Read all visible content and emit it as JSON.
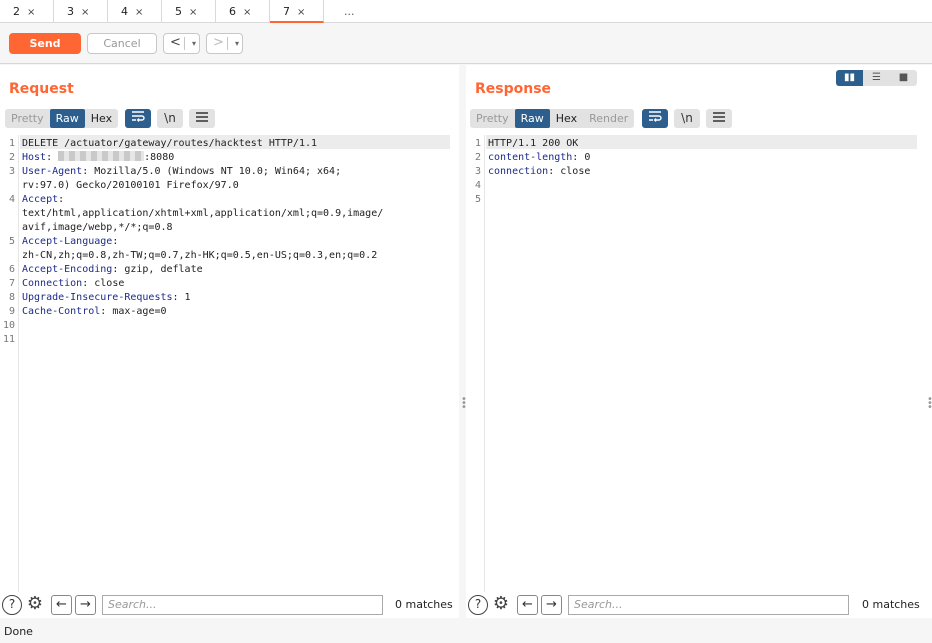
{
  "tabs": [
    {
      "label": "2",
      "close": "×"
    },
    {
      "label": "3",
      "close": "×"
    },
    {
      "label": "4",
      "close": "×"
    },
    {
      "label": "5",
      "close": "×"
    },
    {
      "label": "6",
      "close": "×"
    },
    {
      "label": "7",
      "close": "×"
    }
  ],
  "tabs_more": "...",
  "active_tab": "7",
  "toolbar": {
    "send_label": "Send",
    "cancel_label": "Cancel",
    "back_glyph": "<",
    "forward_glyph": ">",
    "dropdown_glyph": "▾"
  },
  "colors": {
    "accent": "#ff6633",
    "selected": "#2c5f8e"
  },
  "request": {
    "title": "Request",
    "view_modes": [
      "Pretty",
      "Raw",
      "Hex"
    ],
    "active_mode": "Raw",
    "tools": [
      "wrap-icon",
      "\\n",
      "menu-icon"
    ],
    "newline_label": "\\n",
    "lines": [
      {
        "n": "1",
        "key": "",
        "text": "DELETE /actuator/gateway/routes/hacktest HTTP/1.1"
      },
      {
        "n": "2",
        "key": "Host",
        "text": ":8080",
        "redacted": true
      },
      {
        "n": "3",
        "key": "User-Agent",
        "text": ": Mozilla/5.0 (Windows NT 10.0; Win64; x64;"
      },
      {
        "n": "",
        "key": "",
        "text": "rv:97.0) Gecko/20100101 Firefox/97.0"
      },
      {
        "n": "4",
        "key": "Accept",
        "text": ":"
      },
      {
        "n": "",
        "key": "",
        "text": "text/html,application/xhtml+xml,application/xml;q=0.9,image/"
      },
      {
        "n": "",
        "key": "",
        "text": "avif,image/webp,*/*;q=0.8"
      },
      {
        "n": "5",
        "key": "Accept-Language",
        "text": ":"
      },
      {
        "n": "",
        "key": "",
        "text": "zh-CN,zh;q=0.8,zh-TW;q=0.7,zh-HK;q=0.5,en-US;q=0.3,en;q=0.2"
      },
      {
        "n": "6",
        "key": "Accept-Encoding",
        "text": ": gzip, deflate"
      },
      {
        "n": "7",
        "key": "Connection",
        "text": ": close"
      },
      {
        "n": "8",
        "key": "Upgrade-Insecure-Requests",
        "text": ": 1"
      },
      {
        "n": "9",
        "key": "Cache-Control",
        "text": ": max-age=0"
      },
      {
        "n": "10",
        "key": "",
        "text": ""
      },
      {
        "n": "11",
        "key": "",
        "text": ""
      }
    ],
    "search_placeholder": "Search...",
    "matches": "0 matches"
  },
  "response": {
    "title": "Response",
    "view_modes": [
      "Pretty",
      "Raw",
      "Hex",
      "Render"
    ],
    "active_mode": "Raw",
    "newline_label": "\\n",
    "lines": [
      {
        "n": "1",
        "key": "",
        "text": "HTTP/1.1 200 OK"
      },
      {
        "n": "2",
        "key": "content-length",
        "text": ": 0"
      },
      {
        "n": "3",
        "key": "connection",
        "text": ": close"
      },
      {
        "n": "4",
        "key": "",
        "text": ""
      },
      {
        "n": "5",
        "key": "",
        "text": ""
      }
    ],
    "search_placeholder": "Search...",
    "matches": "0 matches"
  },
  "layout_switch": [
    "side-by-side-icon",
    "top-bottom-icon",
    "tabs-icon"
  ],
  "help_glyph": "?",
  "gear_glyph": "⚙",
  "arrow_back": "←",
  "arrow_forward": "→",
  "status": "Done"
}
